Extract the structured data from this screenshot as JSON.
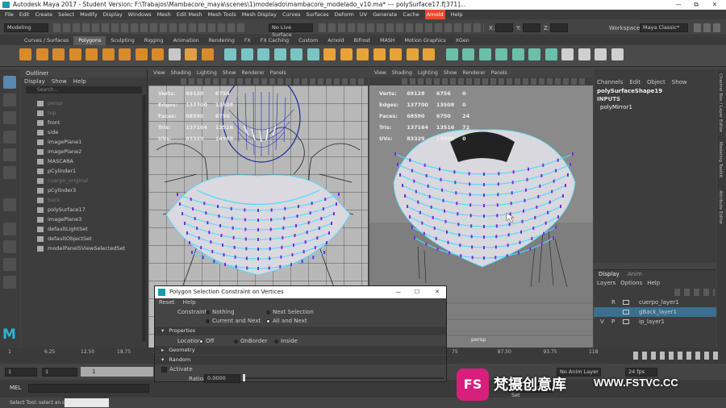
{
  "window": {
    "title": "Autodesk Maya 2017 - Student Version: F:\\Trabajos\\Mambacore_maya\\scenes\\1)modelado\\mambacore_modelado_v10.ma*  ---  polySurface17.f[371]...",
    "minimize": "—",
    "maximize": "⧉",
    "close": "✕"
  },
  "menubar": [
    "File",
    "Edit",
    "Create",
    "Select",
    "Modify",
    "Display",
    "Windows",
    "Mesh",
    "Edit Mesh",
    "Mesh Tools",
    "Mesh Display",
    "Curves",
    "Surfaces",
    "Deform",
    "UV",
    "Generate",
    "Cache",
    "Arnold",
    "Help"
  ],
  "status": {
    "mode": "Modeling",
    "live_surface": "No Live Surface",
    "x_label": "X:",
    "y_label": "Y:",
    "z_label": "Z:",
    "workspace_label": "Workspace :",
    "workspace": "Maya Classic*"
  },
  "shelf_tabs": [
    "Curves / Surfaces",
    "Polygons",
    "Sculpting",
    "Rigging",
    "Animation",
    "Rendering",
    "FX",
    "FX Caching",
    "Custom",
    "Arnold",
    "Bifrost",
    "MASH",
    "Motion Graphics",
    "XGen"
  ],
  "shelf_active": "Polygons",
  "outliner": {
    "title": "Outliner",
    "menu": [
      "Display",
      "Show",
      "Help"
    ],
    "search_placeholder": "Search...",
    "items": [
      {
        "label": "persp",
        "dim": true
      },
      {
        "label": "top",
        "dim": true
      },
      {
        "label": "front",
        "dim": false
      },
      {
        "label": "side",
        "dim": false
      },
      {
        "label": "imagePlane1",
        "dim": false
      },
      {
        "label": "imagePlane2",
        "dim": false
      },
      {
        "label": "MASCARA",
        "dim": false
      },
      {
        "label": "pCylinder1",
        "dim": false
      },
      {
        "label": "cuerpo_original",
        "dim": true
      },
      {
        "label": "pCylinder3",
        "dim": false
      },
      {
        "label": "back",
        "dim": true
      },
      {
        "label": "polySurface17",
        "dim": false
      },
      {
        "label": "imagePlane3",
        "dim": false
      },
      {
        "label": "defaultLightSet",
        "dim": false
      },
      {
        "label": "defaultObjectSet",
        "dim": false
      },
      {
        "label": "modelPanel5ViewSelectedSet",
        "dim": false
      }
    ]
  },
  "viewport_menu": [
    "View",
    "Shading",
    "Lighting",
    "Show",
    "Renderer",
    "Panels"
  ],
  "hud_left": {
    "rows": [
      {
        "k": "Verts:",
        "a": "69128",
        "b": "6756",
        "c": ""
      },
      {
        "k": "Edges:",
        "a": "137700",
        "b": "13508",
        "c": ""
      },
      {
        "k": "Faces:",
        "a": "68590",
        "b": "6750",
        "c": ""
      },
      {
        "k": "Tris:",
        "a": "137164",
        "b": "13516",
        "c": ""
      },
      {
        "k": "UVs:",
        "a": "83329",
        "b": "14988",
        "c": ""
      }
    ]
  },
  "hud_right": {
    "rows": [
      {
        "k": "Verts:",
        "a": "69128",
        "b": "6756",
        "c": "0"
      },
      {
        "k": "Edges:",
        "a": "137700",
        "b": "13508",
        "c": "0"
      },
      {
        "k": "Faces:",
        "a": "68590",
        "b": "6750",
        "c": "24"
      },
      {
        "k": "Tris:",
        "a": "137164",
        "b": "13516",
        "c": "72"
      },
      {
        "k": "UVs:",
        "a": "83329",
        "b": "14988",
        "c": "0"
      }
    ],
    "camera": "persp"
  },
  "channelbox": {
    "menu": [
      "Channels",
      "Edit",
      "Object",
      "Show"
    ],
    "shape": "polySurfaceShape19",
    "inputs": "INPUTS",
    "node": "polyMirror1"
  },
  "layers": {
    "tabs": [
      "Display",
      "Anim"
    ],
    "menu": [
      "Layers",
      "Options",
      "Help"
    ],
    "rows": [
      {
        "v": "",
        "p": "R",
        "name": "cuerpo_layer1",
        "selected": false
      },
      {
        "v": "",
        "p": "",
        "name": "gBack_layer1",
        "selected": true
      },
      {
        "v": "V",
        "p": "P",
        "name": "ip_layer1",
        "selected": false
      }
    ]
  },
  "side_tabs": [
    "Channel Box / Layer Editor",
    "Modeling Toolkit",
    "Attribute Editor"
  ],
  "dialog": {
    "title": "Polygon Selection Constraint on Vertices",
    "menu": [
      "Reset",
      "Help"
    ],
    "constraint_label": "Constraint:",
    "constraint_options": [
      "Nothing",
      "Next Selection",
      "Current and Next",
      "All and Next"
    ],
    "constraint_selected": "All and Next",
    "properties": "Properties",
    "location_label": "Location",
    "location_options": [
      "Off",
      "OnBorder",
      "Inside"
    ],
    "location_selected": "Off",
    "geometry": "Geometry",
    "random": "Random",
    "activate": "Activate",
    "ratio_label": "Ratio",
    "ratio_value": "0.0000"
  },
  "timeline": {
    "ticks_left": [
      "1",
      "6.25",
      "12.50",
      "18.75",
      "2"
    ],
    "ticks_right": [
      "75",
      "87.50",
      "93.75",
      "118"
    ],
    "start": "1",
    "end": "1",
    "current": "1",
    "anim_layer": "No Anim Layer",
    "char_set": "No Character Set",
    "fps": "24 fps"
  },
  "mel": {
    "label": "MEL"
  },
  "helpline": "Select Tool: select an object",
  "watermark": {
    "brand": "梵摄创意库",
    "url": "WWW.FSTVC.CC",
    "logo": "FS"
  },
  "colors": {
    "accent": "#4a90d9",
    "selection": "#3a6f8f",
    "mesh_blue": "#4fd8ff",
    "vertex": "#7a2bd6",
    "arnold": "#e84a2a"
  }
}
